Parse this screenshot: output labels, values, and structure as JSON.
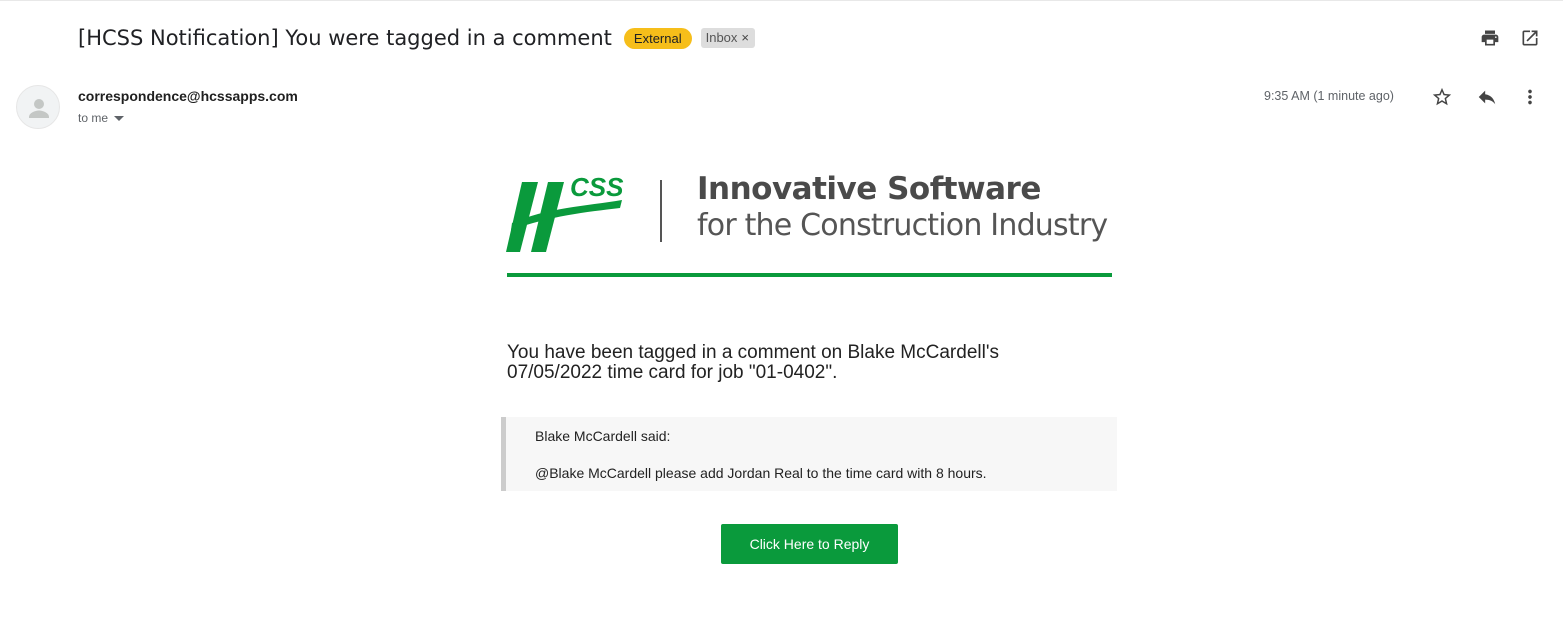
{
  "email": {
    "subject": "[HCSS Notification] You were tagged in a comment",
    "labels": {
      "external": "External",
      "inbox": "Inbox",
      "remove_glyph": "×"
    },
    "sender": "correspondence@hcssapps.com",
    "recipient": "to me",
    "time": "9:35 AM (1 minute ago)"
  },
  "toolbar_icons": [
    "print-icon",
    "open-in-new-window-icon",
    "star-icon",
    "reply-icon",
    "more-vert-icon"
  ],
  "body": {
    "logo_text": "CSS",
    "tagline_line1": "Innovative Software",
    "tagline_line2": "for the Construction Industry",
    "message": "You have been tagged in a comment on Blake McCardell's 07/05/2022 time card for job \"01-0402\".",
    "quote_author": "Blake McCardell said:",
    "quote_text": "@Blake McCardell please add Jordan Real to the time card with 8 hours.",
    "reply_button": "Click Here to Reply"
  },
  "colors": {
    "brand_green": "#0a9a3c",
    "external_label": "#f6be1a",
    "inbox_label": "#dddddd"
  }
}
